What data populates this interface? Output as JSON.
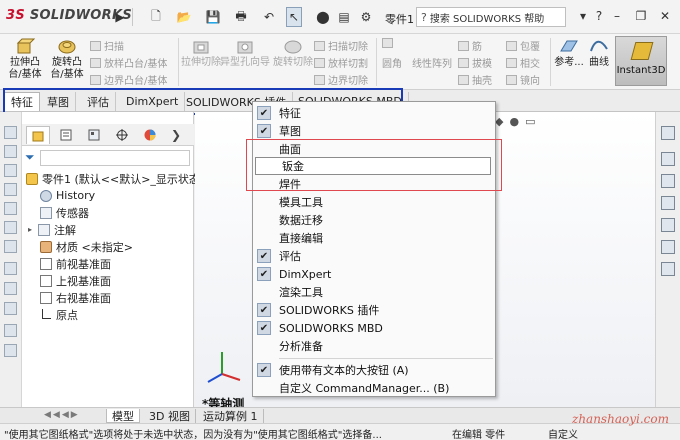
{
  "app": {
    "logo_text_ds": "3S",
    "logo_text_sw": "SOLIDWORKS",
    "document_name": "零件1",
    "search_placeholder": "搜索 SOLIDWORKS 帮助"
  },
  "ribbon": {
    "big_buttons": [
      {
        "label": "拉伸凸台/基体"
      },
      {
        "label": "旋转凸台/基体"
      }
    ],
    "small_group1": [
      "扫描",
      "放样凸台/基体",
      "边界凸台/基体"
    ],
    "mid_buttons": [
      "拉伸切除",
      "异型孔向导",
      "旋转切除"
    ],
    "small_group2": [
      "扫描切除",
      "放样切割",
      "边界切除"
    ],
    "small_group3": [
      "圆角",
      "线性阵列"
    ],
    "small_group4": [
      "筋",
      "拔模",
      "抽壳"
    ],
    "small_group5": [
      "包覆",
      "相交",
      "镜向"
    ],
    "right_buttons": [
      "参考...",
      "曲线"
    ],
    "instant3d_label": "Instant3D"
  },
  "command_tabs": [
    "特征",
    "草图",
    "评估",
    "DimXpert",
    "SOLIDWORKS 插件",
    "SOLIDWORKS MBD"
  ],
  "feature_tree": {
    "root": "零件1 (默认<<默认>_显示状态",
    "items": [
      {
        "label": "History",
        "icon": "history-icon"
      },
      {
        "label": "传感器",
        "icon": "sensor-icon"
      },
      {
        "label": "注解",
        "icon": "annotation-icon",
        "expandable": true
      },
      {
        "label": "材质 <未指定>",
        "icon": "material-icon"
      },
      {
        "label": "前视基准面",
        "icon": "plane-icon"
      },
      {
        "label": "上视基准面",
        "icon": "plane-icon"
      },
      {
        "label": "右视基准面",
        "icon": "plane-icon"
      },
      {
        "label": "原点",
        "icon": "origin-icon"
      }
    ]
  },
  "graphics": {
    "view_label": "*等轴测"
  },
  "context_menu": {
    "items": [
      {
        "label": "特征",
        "checked": true
      },
      {
        "label": "草图",
        "checked": true
      },
      {
        "label": "曲面",
        "checked": false
      },
      {
        "label": "钣金",
        "checked": false,
        "hover": true
      },
      {
        "label": "焊件",
        "checked": false
      },
      {
        "label": "模具工具",
        "checked": false
      },
      {
        "label": "数据迁移",
        "checked": false
      },
      {
        "label": "直接编辑",
        "checked": false
      },
      {
        "label": "评估",
        "checked": true
      },
      {
        "label": "DimXpert",
        "checked": true
      },
      {
        "label": "渲染工具",
        "checked": false
      },
      {
        "label": "SOLIDWORKS 插件",
        "checked": true
      },
      {
        "label": "SOLIDWORKS MBD",
        "checked": true
      },
      {
        "label": "分析准备",
        "checked": false
      }
    ],
    "footer_items": [
      {
        "label": "使用带有文本的大按钮 (A)",
        "checked": true
      },
      {
        "label": "自定义 CommandManager... (B)",
        "checked": false
      }
    ]
  },
  "sheet_tabs": [
    "模型",
    "3D 视图",
    "运动算例 1"
  ],
  "status": {
    "message": "\"使用其它图纸格式\"选项将处于未选中状态，因为没有为\"使用其它图纸格式\"选择备...",
    "mode": "在编辑 零件",
    "custom": "自定义"
  },
  "watermark": "zhanshaoyi.com"
}
